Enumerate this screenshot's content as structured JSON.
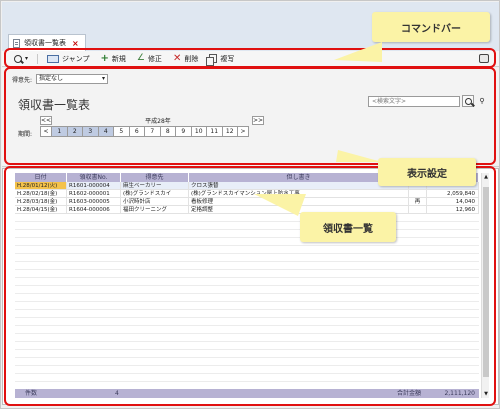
{
  "tab": {
    "label": "領収書一覧表",
    "close": "×"
  },
  "toolbar": {
    "jump": "ジャンプ",
    "new": "新規",
    "edit": "修正",
    "delete": "削除",
    "copy": "複写"
  },
  "settings": {
    "recipient_label": "得意先:",
    "recipient_value": "指定なし",
    "title": "領収書一覧表",
    "search_placeholder": "<検索文字>",
    "period_label": "期間:",
    "nav_prev": "<<",
    "nav_next": ">>",
    "era": "平成28年",
    "month_prev": "<",
    "month_next": ">",
    "months": [
      "1",
      "2",
      "3",
      "4",
      "5",
      "6",
      "7",
      "8",
      "9",
      "10",
      "11",
      "12"
    ]
  },
  "table": {
    "columns": [
      "日付",
      "領収書No.",
      "得意先",
      "但し書き",
      "",
      ""
    ],
    "rows": [
      {
        "date": "H.28/01/12(火)",
        "no": "R1601-000004",
        "customer": "麻生ベーカリー",
        "memo": "クロス張替",
        "mark": "",
        "amount": ""
      },
      {
        "date": "H.28/02/18(金)",
        "no": "R1602-000001",
        "customer": "(株)グランドスカイ",
        "memo": "(株)グランドスカイマンション屋上防水工事",
        "mark": "",
        "amount": "2,059,840"
      },
      {
        "date": "H.28/03/18(金)",
        "no": "R1603-000005",
        "customer": "小沢時計店",
        "memo": "看板修理",
        "mark": "再",
        "amount": "14,040"
      },
      {
        "date": "H.28/04/15(金)",
        "no": "R1604-000006",
        "customer": "福田クリーニング",
        "memo": "定格調整",
        "mark": "",
        "amount": "12,960"
      }
    ],
    "footer_count_label": "件数",
    "footer_count": "4",
    "footer_total_label": "合計金額",
    "footer_total": "2,111,120"
  },
  "callouts": {
    "command_bar": "コマンドバー",
    "display_settings": "表示設定",
    "receipt_list": "領収書一覧"
  },
  "colors": {
    "highlight": "#e01010",
    "callout": "#fbf3a6",
    "header": "#b7b2d3",
    "selected_cell": "#f4c24b"
  }
}
